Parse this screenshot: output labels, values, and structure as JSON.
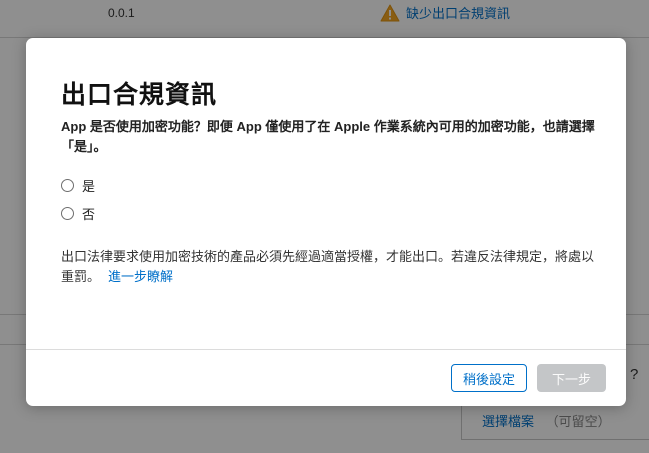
{
  "background": {
    "version": "0.0.1",
    "warning_text": "缺少出口合規資訊",
    "help_glyph": "?",
    "upload_link": "選擇檔案",
    "upload_optional": "（可留空）"
  },
  "modal": {
    "title": "出口合規資訊",
    "question": "App 是否使用加密功能？即便 App 僅使用了在 Apple 作業系統內可用的加密功能，也請選擇「是」。",
    "options": [
      {
        "label": "是",
        "selected": false
      },
      {
        "label": "否",
        "selected": false
      }
    ],
    "notice": "出口法律要求使用加密技術的產品必須先經過適當授權，才能出口。若違反法律規定，將處以重罰。",
    "learn_more": "進一步瞭解",
    "buttons": {
      "later": "稍後設定",
      "next": "下一步"
    }
  },
  "colors": {
    "accent": "#0070c9",
    "warning": "#f5a623",
    "disabled_button": "#c4c6c8"
  }
}
